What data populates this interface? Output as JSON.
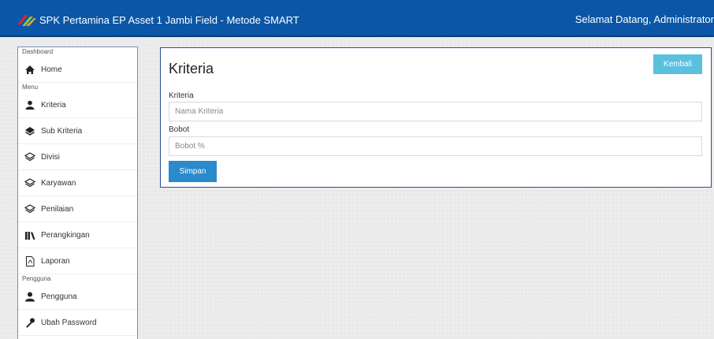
{
  "navbar": {
    "brand": "SPK Pertamina EP Asset 1 Jambi Field - Metode SMART",
    "welcome": "Selamat Datang, Administrator"
  },
  "sidebar": {
    "sections": [
      {
        "heading": "Dashboard",
        "items": [
          {
            "label": "Home",
            "icon": "home-icon"
          }
        ]
      },
      {
        "heading": "Menu",
        "items": [
          {
            "label": "Kriteria",
            "icon": "users-icon"
          },
          {
            "label": "Sub Kriteria",
            "icon": "layer-icon"
          },
          {
            "label": "Divisi",
            "icon": "layers-icon"
          },
          {
            "label": "Karyawan",
            "icon": "layers-icon"
          },
          {
            "label": "Penilaian",
            "icon": "layers-icon"
          },
          {
            "label": "Perangkingan",
            "icon": "ranking-icon"
          },
          {
            "label": "Laporan",
            "icon": "pdf-file-icon"
          }
        ]
      },
      {
        "heading": "Pengguna",
        "items": [
          {
            "label": "Pengguna",
            "icon": "user-icon"
          },
          {
            "label": "Ubah Password",
            "icon": "wrench-icon"
          }
        ]
      }
    ]
  },
  "panel": {
    "title": "Kriteria",
    "back_button": "Kembali",
    "fields": [
      {
        "label": "Kriteria",
        "placeholder": "Nama Kriteria",
        "value": ""
      },
      {
        "label": "Bobot",
        "placeholder": "Bobot %",
        "value": ""
      }
    ],
    "save_button": "Simpan"
  },
  "colors": {
    "navbar": "#0b56a6",
    "btn_info": "#5bc0de",
    "btn_primary": "#2a8acc",
    "panel_border": "#2a4a9f"
  }
}
